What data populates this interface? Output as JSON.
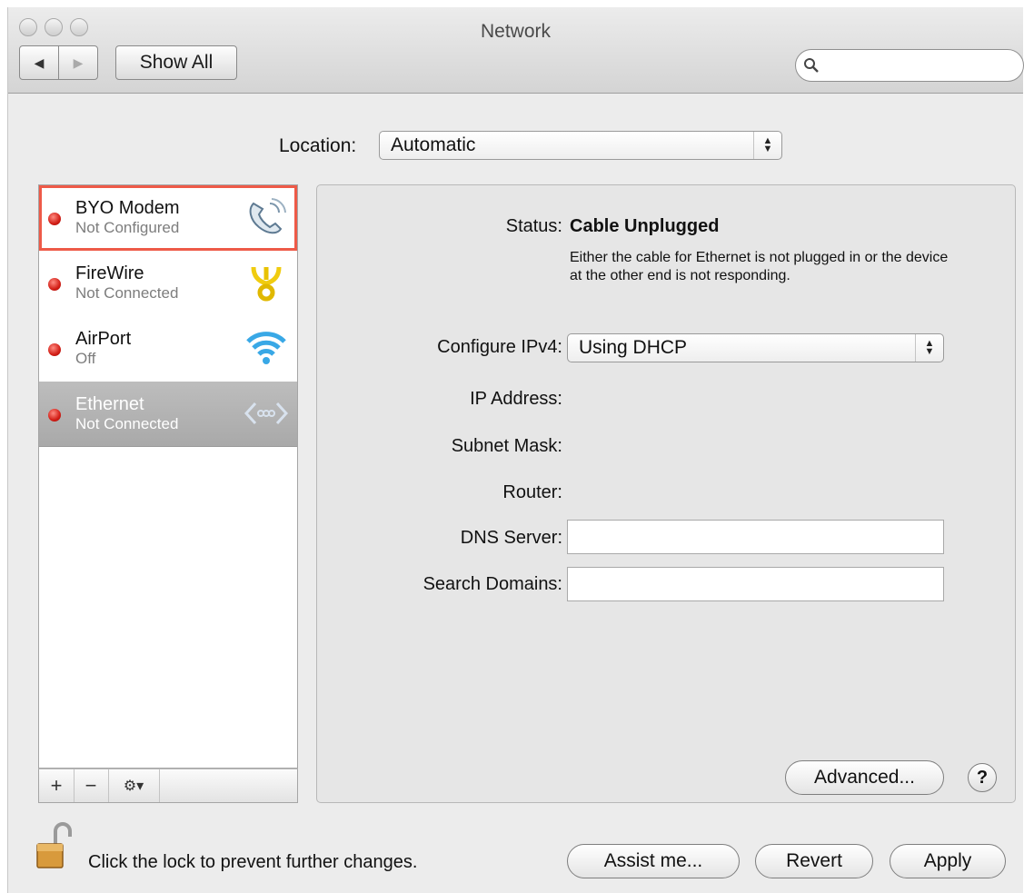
{
  "window": {
    "title": "Network"
  },
  "toolbar": {
    "show_all_label": "Show All",
    "search_placeholder": ""
  },
  "location": {
    "label": "Location:",
    "value": "Automatic"
  },
  "services": [
    {
      "name": "BYO Modem",
      "status": "Not Configured",
      "icon": "modem-phone-icon"
    },
    {
      "name": "FireWire",
      "status": "Not Connected",
      "icon": "firewire-icon"
    },
    {
      "name": "AirPort",
      "status": "Off",
      "icon": "airport-wifi-icon"
    },
    {
      "name": "Ethernet",
      "status": "Not Connected",
      "icon": "ethernet-icon"
    }
  ],
  "list_bar": {
    "add": "+",
    "remove": "−",
    "gear": "⚙▾"
  },
  "detail": {
    "status_label": "Status:",
    "status_value": "Cable Unplugged",
    "status_description": "Either the cable for Ethernet is not plugged in or the device at the other end is not responding.",
    "configure_label": "Configure IPv4:",
    "configure_value": "Using DHCP",
    "ip_label": "IP Address:",
    "subnet_label": "Subnet Mask:",
    "router_label": "Router:",
    "dns_label": "DNS Server:",
    "search_domains_label": "Search Domains:",
    "advanced_label": "Advanced...",
    "help_label": "?"
  },
  "footer": {
    "lock_text": "Click the lock to prevent further changes.",
    "assist_label": "Assist me...",
    "revert_label": "Revert",
    "apply_label": "Apply"
  },
  "colors": {
    "status_red": "#d21e16",
    "selection_gray": "#a9a9a9",
    "highlight_outline": "#ee5a48"
  }
}
